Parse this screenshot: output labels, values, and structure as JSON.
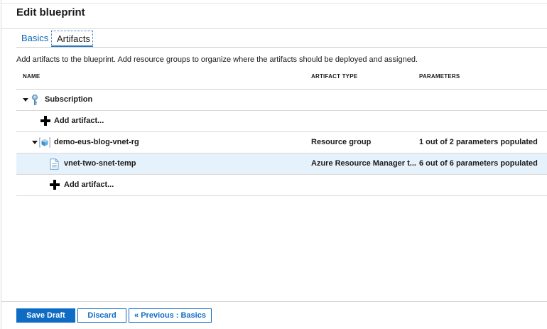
{
  "header": {
    "title": "Edit blueprint"
  },
  "tabs": [
    {
      "label": "Basics"
    },
    {
      "label": "Artifacts"
    }
  ],
  "description": "Add artifacts to the blueprint. Add resource groups to organize where the artifacts should be deployed and assigned.",
  "table": {
    "columns": {
      "name": "NAME",
      "type": "ARTIFACT TYPE",
      "params": "PARAMETERS"
    },
    "rows": [
      {
        "name": "Subscription",
        "type": "",
        "params": ""
      },
      {
        "name": "Add artifact...",
        "type": "",
        "params": ""
      },
      {
        "name": "demo-eus-blog-vnet-rg",
        "type": "Resource group",
        "params": "1 out of 2 parameters populated"
      },
      {
        "name": "vnet-two-snet-temp",
        "type": "Azure Resource Manager t...",
        "params": "6 out of 6 parameters populated"
      },
      {
        "name": "Add artifact...",
        "type": "",
        "params": ""
      }
    ]
  },
  "footer": {
    "save_label": "Save Draft",
    "discard_label": "Discard",
    "previous_label": "« Previous : Basics"
  },
  "colors": {
    "accent": "#0f6cc4",
    "link": "#0a64b4",
    "selected_row": "#e6f2fb"
  },
  "icons": {
    "subscription": "key-icon",
    "resource_group": "resource-group-cube-icon",
    "template": "document-icon",
    "add": "plus-icon",
    "expand": "caret-down-icon"
  }
}
